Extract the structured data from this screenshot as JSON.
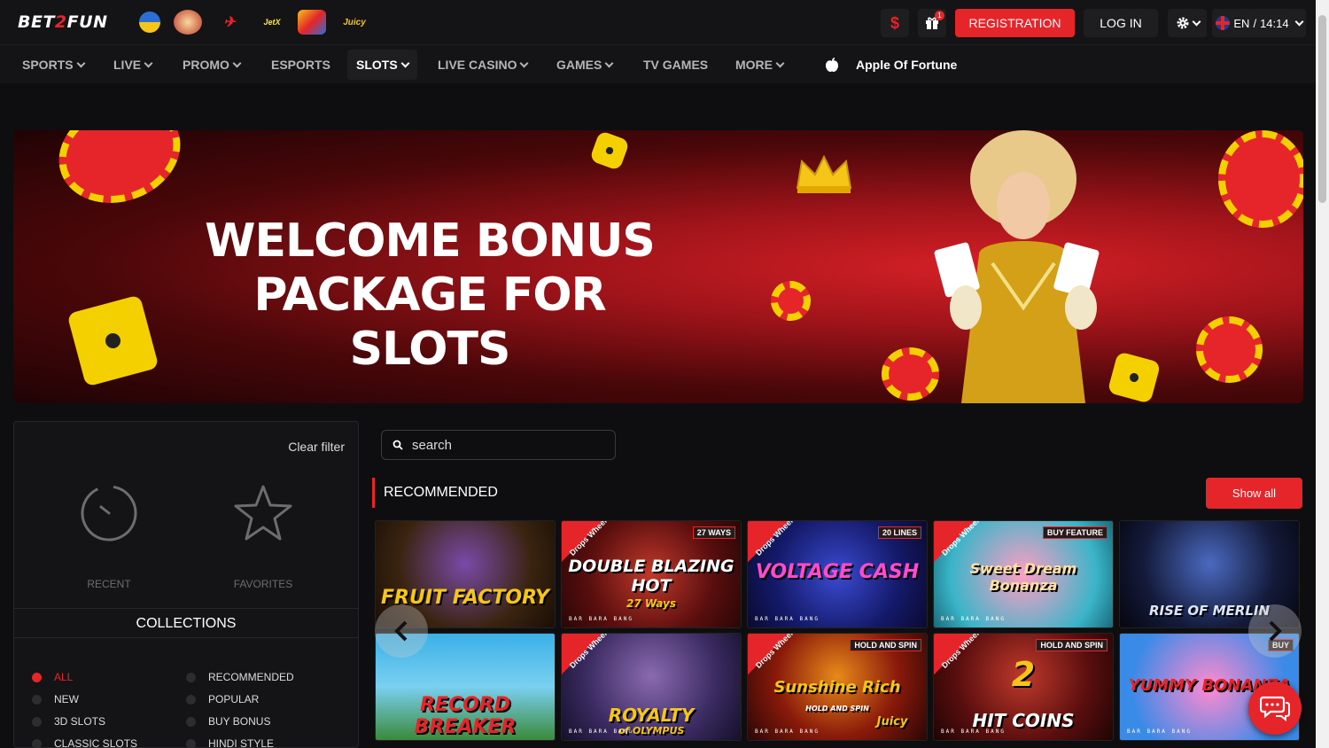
{
  "header": {
    "logo_a": "BET",
    "logo_b": "2",
    "logo_c": "FUN",
    "game_icons": [
      "Crazy Time",
      "Aviator",
      "JetX",
      "Sweet Bonanza",
      "Juicy"
    ],
    "jetx_label": "JetX",
    "juicy_label": "Juicy",
    "currency_symbol": "$",
    "gift_badge": "1",
    "registration_label": "REGISTRATION",
    "login_label": "LOG IN",
    "language": "EN",
    "separator": "/",
    "time": "14:14"
  },
  "nav": {
    "items": [
      {
        "label": "SPORTS"
      },
      {
        "label": "LIVE"
      },
      {
        "label": "PROMO"
      },
      {
        "label": "ESPORTS"
      },
      {
        "label": "SLOTS"
      },
      {
        "label": "LIVE CASINO"
      },
      {
        "label": "GAMES"
      },
      {
        "label": "TV GAMES"
      },
      {
        "label": "MORE"
      }
    ],
    "active": "SLOTS",
    "featured_label": "Apple Of Fortune"
  },
  "banner": {
    "line1": "WELCOME BONUS",
    "line2": "PACKAGE FOR SLOTS"
  },
  "filter": {
    "clear_label": "Clear filter",
    "recent_label": "RECENT",
    "favorites_label": "FAVORITES",
    "collections_title": "COLLECTIONS",
    "collections": [
      {
        "label": "ALL",
        "active": true
      },
      {
        "label": "RECOMMENDED"
      },
      {
        "label": "NEW"
      },
      {
        "label": "POPULAR"
      },
      {
        "label": "3D SLOTS"
      },
      {
        "label": "BUY BONUS"
      },
      {
        "label": "CLASSIC SLOTS"
      },
      {
        "label": "HINDI STYLE"
      }
    ]
  },
  "search": {
    "placeholder": "search"
  },
  "recommended": {
    "title": "RECOMMENDED",
    "show_all": "Show all",
    "drops_label": "Drops Wheels",
    "bbb": "BAR BARA BANG",
    "games": [
      {
        "title": "FRUIT FACTORY"
      },
      {
        "title": "DOUBLE BLAZING HOT",
        "sub": "27 Ways",
        "tag": "27 WAYS"
      },
      {
        "title": "VOLTAGE CASH",
        "tag": "20 LINES"
      },
      {
        "title": "Sweet Dream Bonanza",
        "tag": "BUY FEATURE"
      },
      {
        "title": "RISE OF MERLIN"
      },
      {
        "title": "RECORD BREAKER"
      },
      {
        "title": "ROYALTY",
        "sub": "of OLYMPUS"
      },
      {
        "title": "Sunshine Rich",
        "sub": "HOLD AND SPIN",
        "brand": "Juicy",
        "tag": "HOLD AND SPIN"
      },
      {
        "title": "HIT COINS",
        "num": "2",
        "tag": "HOLD AND SPIN"
      },
      {
        "title": "YUMMY BONANZA",
        "tag": "BUY"
      }
    ]
  }
}
